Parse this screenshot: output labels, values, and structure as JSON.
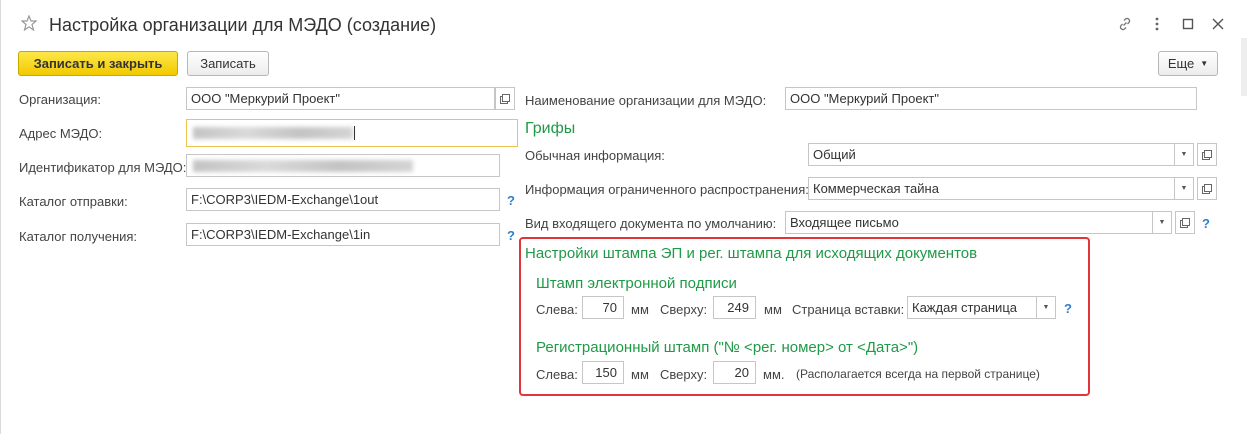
{
  "window": {
    "title": "Настройка организации для МЭДО (создание)"
  },
  "toolbar": {
    "save_close_label": "Записать и закрыть",
    "save_label": "Записать",
    "more_label": "Еще"
  },
  "left": {
    "organization": {
      "label": "Организация:",
      "value": "ООО \"Меркурий Проект\""
    },
    "address": {
      "label": "Адрес МЭДО:"
    },
    "identifier": {
      "label": "Идентификатор для МЭДО:"
    },
    "send_dir": {
      "label": "Каталог отправки:",
      "value": "F:\\CORP3\\IEDM-Exchange\\1out",
      "help": "?"
    },
    "recv_dir": {
      "label": "Каталог получения:",
      "value": "F:\\CORP3\\IEDM-Exchange\\1in",
      "help": "?"
    }
  },
  "right": {
    "org_name": {
      "label": "Наименование организации для МЭДО:",
      "value": "ООО \"Меркурий Проект\""
    },
    "grify_title": "Грифы",
    "normal_info": {
      "label": "Обычная информация:",
      "value": "Общий"
    },
    "restricted_info": {
      "label": "Информация ограниченного распространения:",
      "value": "Коммерческая тайна"
    },
    "incoming_type": {
      "label": "Вид входящего документа по умолчанию:",
      "value": "Входящее письмо",
      "help": "?"
    }
  },
  "stamps": {
    "title": "Настройки штампа ЭП и рег. штампа для исходящих документов",
    "ep": {
      "title": "Штамп электронной подписи",
      "left_label": "Слева:",
      "left_value": "70",
      "left_unit": "мм",
      "top_label": "Сверху:",
      "top_value": "249",
      "top_unit": "мм",
      "page_label": "Страница вставки:",
      "page_value": "Каждая страница",
      "help": "?"
    },
    "reg": {
      "title": "Регистрационный штамп (\"№ <рег. номер> от <Дата>\")",
      "left_label": "Слева:",
      "left_value": "150",
      "left_unit": "мм",
      "top_label": "Сверху:",
      "top_value": "20",
      "top_unit": "мм.",
      "note": "(Располагается всегда на первой странице)"
    }
  },
  "colors": {
    "section_green": "#1f9a47",
    "highlight_red": "#e0353a",
    "primary_yellow": "#f2c900",
    "help_blue": "#2f7fcd"
  }
}
